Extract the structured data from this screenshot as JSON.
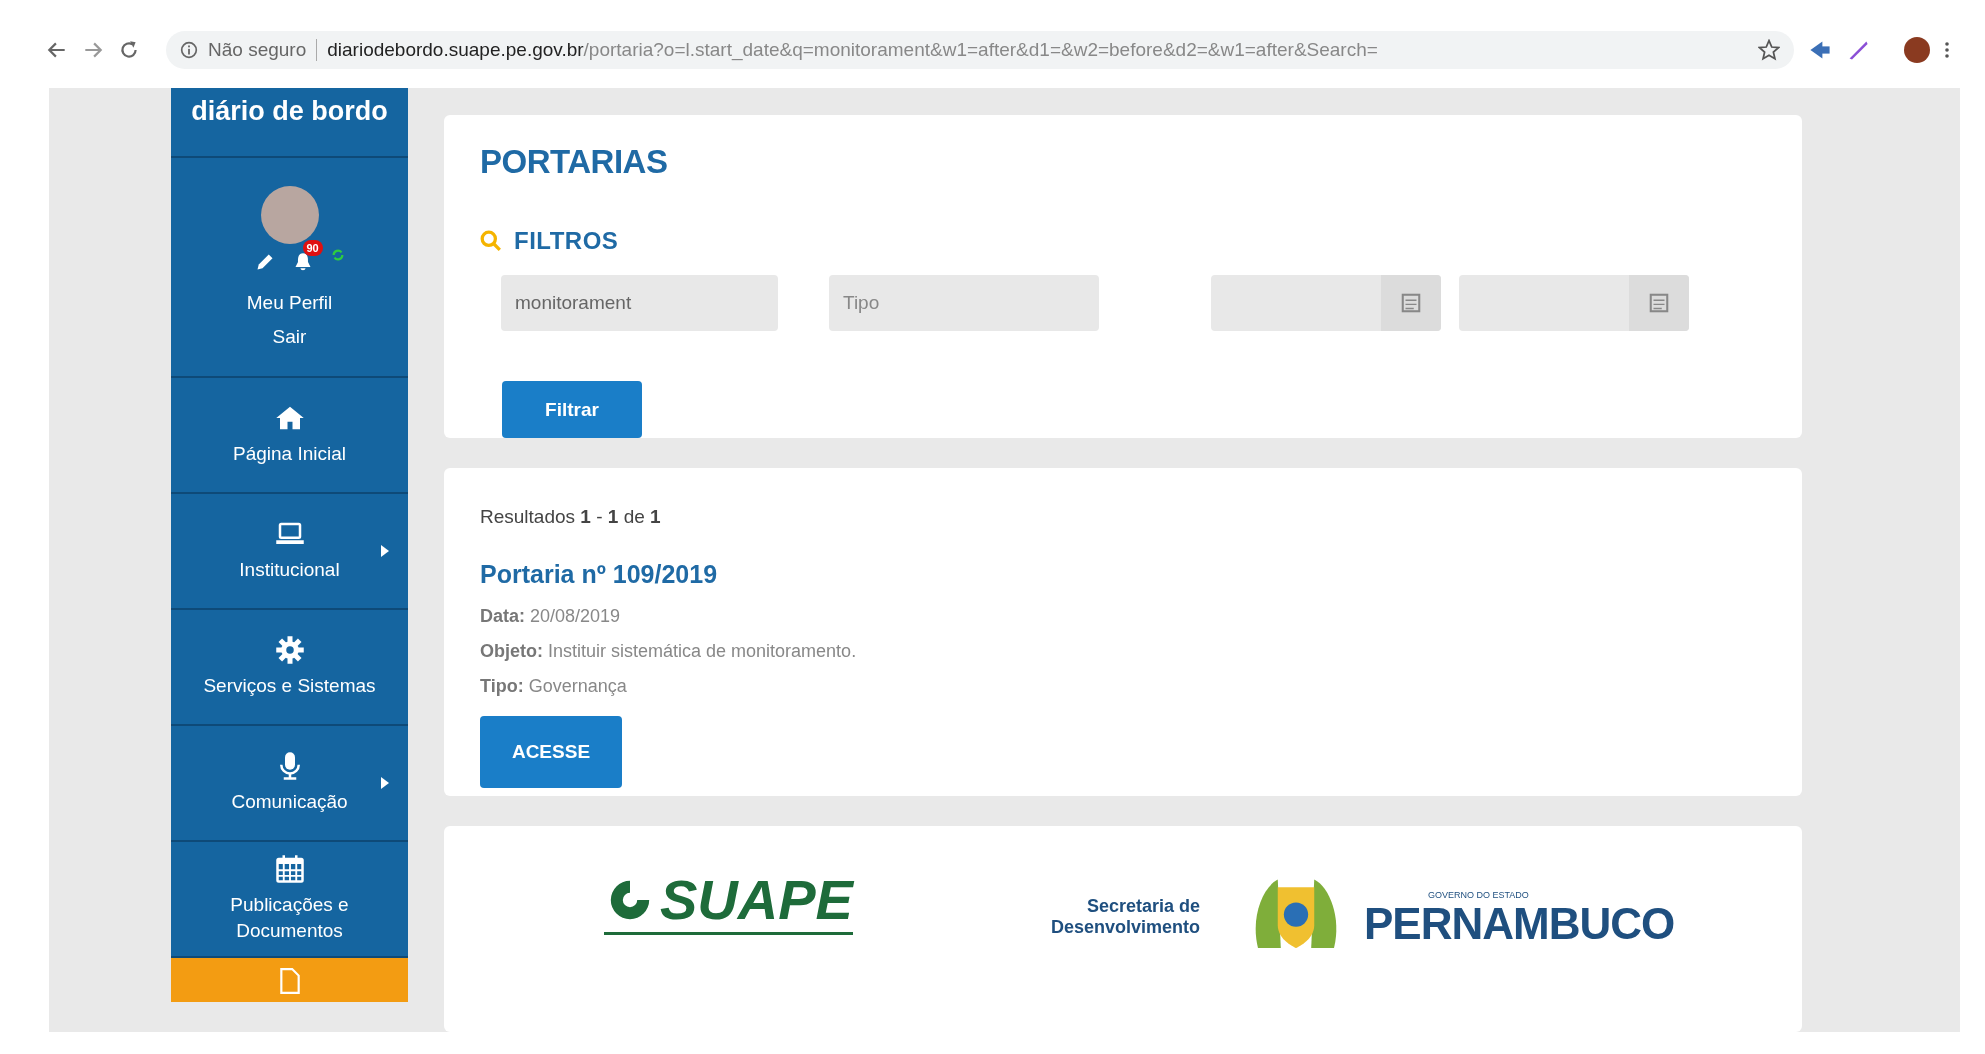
{
  "browser": {
    "security": "Não seguro",
    "url_host": "diariodebordo.suape.pe.gov.br",
    "url_path": "/portaria?o=l.start_date&q=monitorament&w1=after&d1=&w2=before&d2=&w1=after&Search="
  },
  "sidebar": {
    "title": "diário de bordo",
    "profile": {
      "notification_count": "90",
      "links": [
        "Meu Perfil",
        "Sair"
      ]
    },
    "items": [
      {
        "kind": "home",
        "label": "Página Inicial",
        "submenu": false,
        "selected": false
      },
      {
        "kind": "laptop",
        "label": "Institucional",
        "submenu": true,
        "selected": false
      },
      {
        "kind": "gear",
        "label": "Serviços e Sistemas",
        "submenu": false,
        "selected": false
      },
      {
        "kind": "mic",
        "label": "Comunicação",
        "submenu": true,
        "selected": false
      },
      {
        "kind": "calendar",
        "label": "Publicações e Documentos",
        "submenu": false,
        "selected": false
      },
      {
        "kind": "document",
        "submenu": false,
        "selected": true
      }
    ]
  },
  "filters": {
    "title": "PORTARIAS",
    "heading": "FILTROS",
    "search_value": "monitorament",
    "type_placeholder": "Tipo",
    "button": "Filtrar"
  },
  "results": {
    "summary": "Resultados **1** - **1** de **1**",
    "items": [
      {
        "title": "Portaria nº 109/2019",
        "fields": [
          {
            "label": "Data:",
            "value": "20/08/2019"
          },
          {
            "label": "Objeto:",
            "value": "Instituir sistemática de monitoramento."
          },
          {
            "label": "Tipo:",
            "value": "Governança"
          }
        ],
        "button": "ACESSE"
      }
    ]
  },
  "footer": {
    "logo1": "SUAPE",
    "secretaria": [
      "Secretaria de",
      "Desenvolvimento"
    ],
    "gov_small": "GOVERNO DO ESTADO",
    "gov_name": "PERNAMBUCO"
  }
}
